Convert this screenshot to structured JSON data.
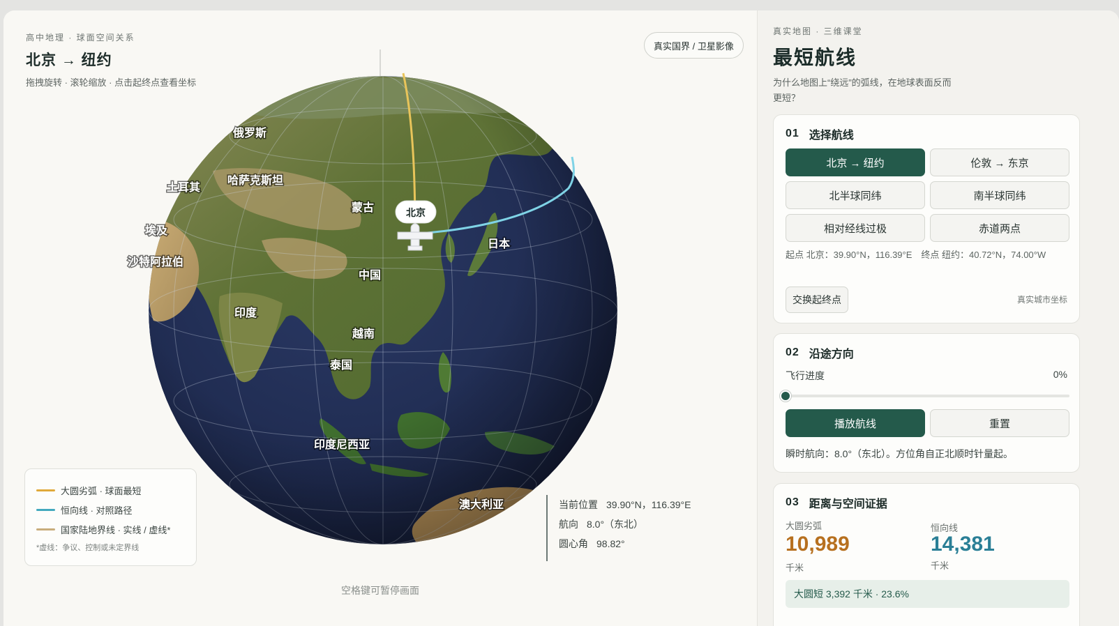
{
  "header": {
    "kicker": "高中地理 · 球面空间关系",
    "route_title": "北京 → 纽约",
    "hint": "拖拽旋转 · 滚轮缩放 · 点击起终点查看坐标",
    "imagery_toggle": "真实国界 / 卫星影像"
  },
  "globe": {
    "place_labels": [
      {
        "name": "俄罗斯"
      },
      {
        "name": "哈萨克斯坦"
      },
      {
        "name": "土耳其"
      },
      {
        "name": "蒙古"
      },
      {
        "name": "埃及"
      },
      {
        "name": "沙特阿拉伯"
      },
      {
        "name": "日本"
      },
      {
        "name": "中国"
      },
      {
        "name": "印度"
      },
      {
        "name": "越南"
      },
      {
        "name": "泰国"
      },
      {
        "name": "印度尼西亚"
      },
      {
        "name": "澳大利亚"
      }
    ],
    "marker_label": "北京",
    "colors": {
      "ocean": "#1f2c52",
      "land": "#6b7a3c",
      "great_circle": "#e8c45a",
      "rhumb_line": "#7fd3e6"
    }
  },
  "legend": {
    "items": [
      {
        "label": "大圆劣弧 · 球面最短",
        "color": "#e0a93a"
      },
      {
        "label": "恒向线 · 对照路径",
        "color": "#43a9be"
      },
      {
        "label": "国家陆地界线 · 实线 / 虚线*",
        "color": "#c8ad7c"
      }
    ],
    "note": "*虚线：争议、控制或未定界线"
  },
  "readout": {
    "position_label": "当前位置",
    "position_value": "39.90°N，116.39°E",
    "heading_label": "航向",
    "heading_value": "8.0°（东北）",
    "angle_label": "圆心角",
    "angle_value": "98.82°"
  },
  "pause_hint": "空格键可暂停画面",
  "side": {
    "kicker": "真实地图 · 三维课堂",
    "title": "最短航线",
    "subtitle": "为什么地图上“绕远”的弧线，在地球表面反而更短？"
  },
  "routes_card": {
    "num": "01",
    "title": "选择航线",
    "options": [
      "北京 → 纽约",
      "伦敦 → 东京",
      "北半球同纬",
      "南半球同纬",
      "相对经线过极",
      "赤道两点"
    ],
    "selected": "北京 → 纽约",
    "coords_text": "起点 北京：39.90°N，116.39°E　终点 纽约：40.72°N，74.00°W",
    "swap_button": "交换起终点",
    "source_note": "真实城市坐标"
  },
  "direction_card": {
    "num": "02",
    "title": "沿途方向",
    "progress_label": "飞行进度",
    "progress_text": "0%",
    "progress": 0,
    "play_button": "播放航线",
    "reset_button": "重置",
    "heading_text": "瞬时航向：8.0°（东北）。方位角自正北顺时针量起。"
  },
  "distance_card": {
    "num": "03",
    "title": "距离与空间证据",
    "gc_label": "大圆劣弧",
    "gc_value": "10,989",
    "gc_unit": "千米",
    "gc_color": "#b7701f",
    "rhumb_label": "恒向线",
    "rhumb_value": "14,381",
    "rhumb_unit": "千米",
    "rhumb_color": "#2a7f96",
    "diff_text": "大圆短 3,392 千米 · 23.6%"
  }
}
